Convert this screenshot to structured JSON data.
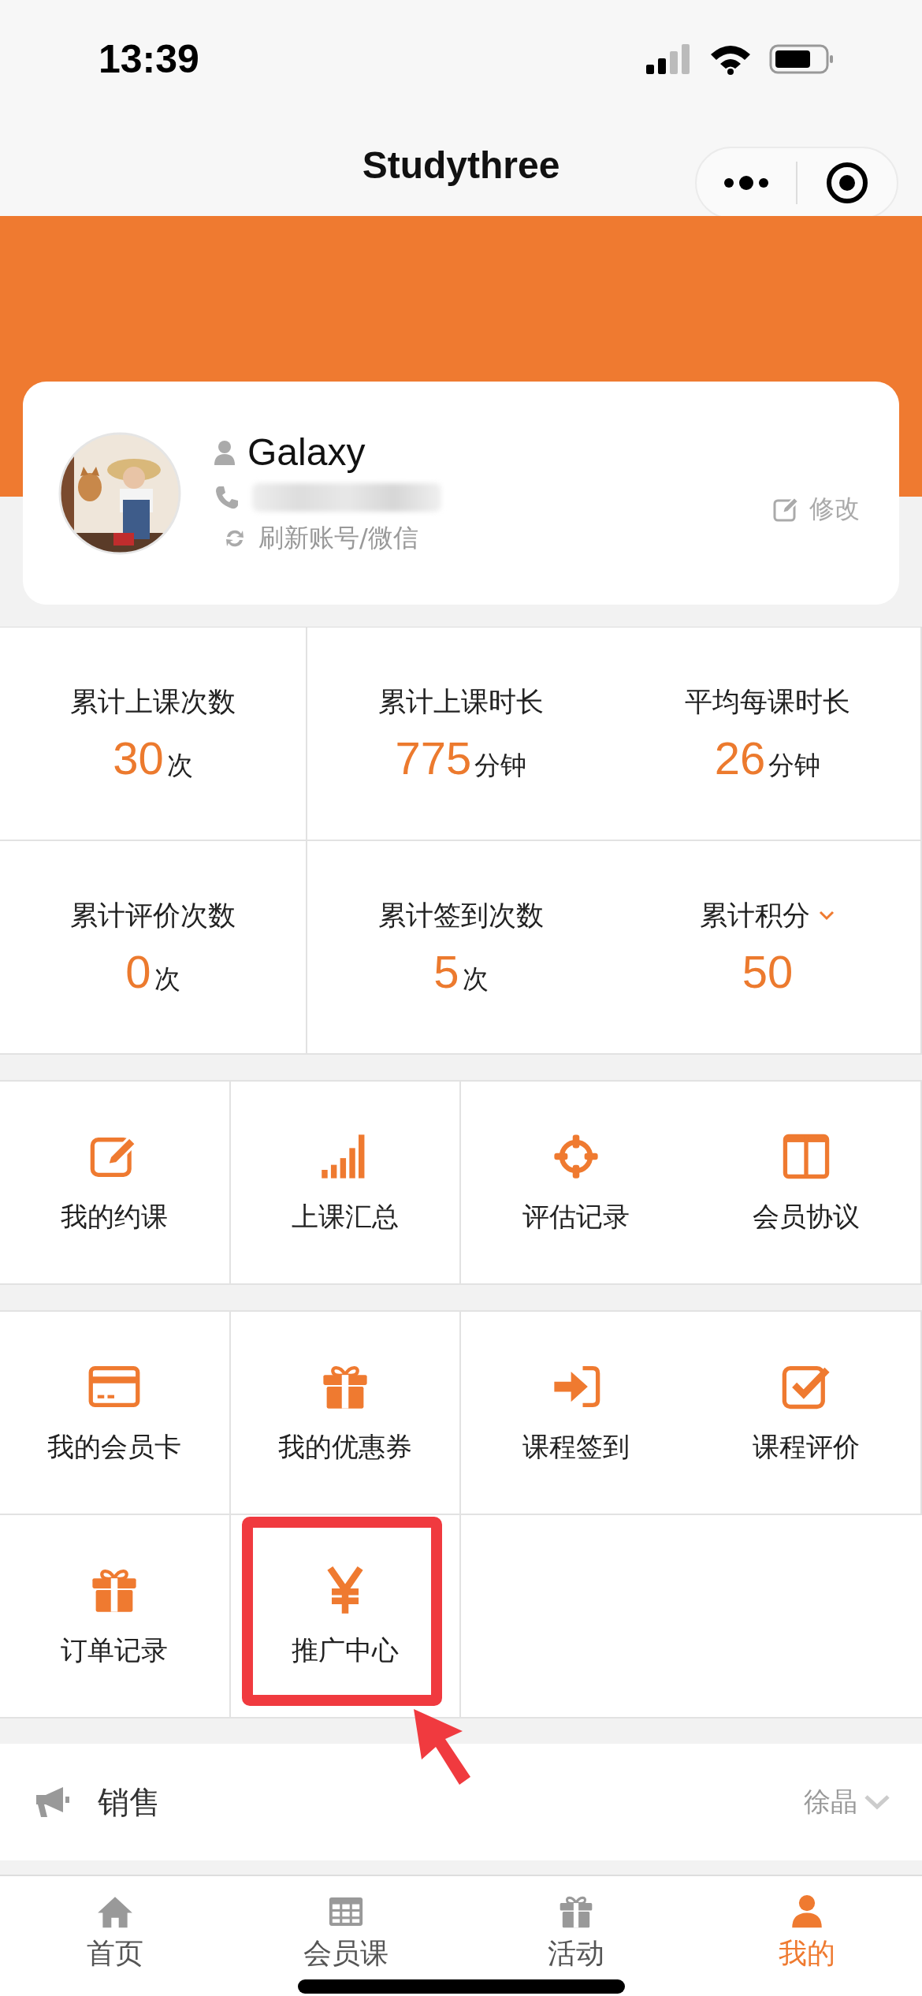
{
  "status_bar": {
    "time": "13:39"
  },
  "nav_bar": {
    "title": "Studythree"
  },
  "profile": {
    "name": "Galaxy",
    "refresh_label": "刷新账号/微信",
    "edit_label": "修改"
  },
  "stats": [
    {
      "label": "累计上课次数",
      "value": "30",
      "unit": "次",
      "dropdown": false
    },
    {
      "label": "累计上课时长",
      "value": "775",
      "unit": "分钟",
      "dropdown": false
    },
    {
      "label": "平均每课时长",
      "value": "26",
      "unit": "分钟",
      "dropdown": false
    },
    {
      "label": "累计评价次数",
      "value": "0",
      "unit": "次",
      "dropdown": false
    },
    {
      "label": "累计签到次数",
      "value": "5",
      "unit": "次",
      "dropdown": false
    },
    {
      "label": "累计积分",
      "value": "50",
      "dropdown": true
    }
  ],
  "menu_groups": [
    [
      {
        "label": "我的约课",
        "kind": "edit",
        "highlighted": false
      },
      {
        "label": "上课汇总",
        "kind": "bars",
        "highlighted": false
      },
      {
        "label": "评估记录",
        "kind": "target",
        "highlighted": false
      },
      {
        "label": "会员协议",
        "kind": "columns",
        "highlighted": false
      }
    ],
    [
      {
        "label": "我的会员卡",
        "kind": "card",
        "highlighted": false
      },
      {
        "label": "我的优惠券",
        "kind": "gift",
        "highlighted": false
      },
      {
        "label": "课程签到",
        "kind": "signin",
        "highlighted": false
      },
      {
        "label": "课程评价",
        "kind": "check",
        "highlighted": false
      },
      {
        "label": "订单记录",
        "kind": "gift",
        "highlighted": false
      },
      {
        "label": "推广中心",
        "kind": "yen",
        "highlighted": true
      }
    ]
  ],
  "sales": {
    "label": "销售",
    "value": "徐晶"
  },
  "tabs": [
    {
      "label": "首页",
      "kind": "home",
      "selected": false
    },
    {
      "label": "会员课",
      "kind": "grid",
      "selected": false
    },
    {
      "label": "活动",
      "kind": "gift",
      "selected": false
    },
    {
      "label": "我的",
      "kind": "person",
      "selected": true
    }
  ]
}
